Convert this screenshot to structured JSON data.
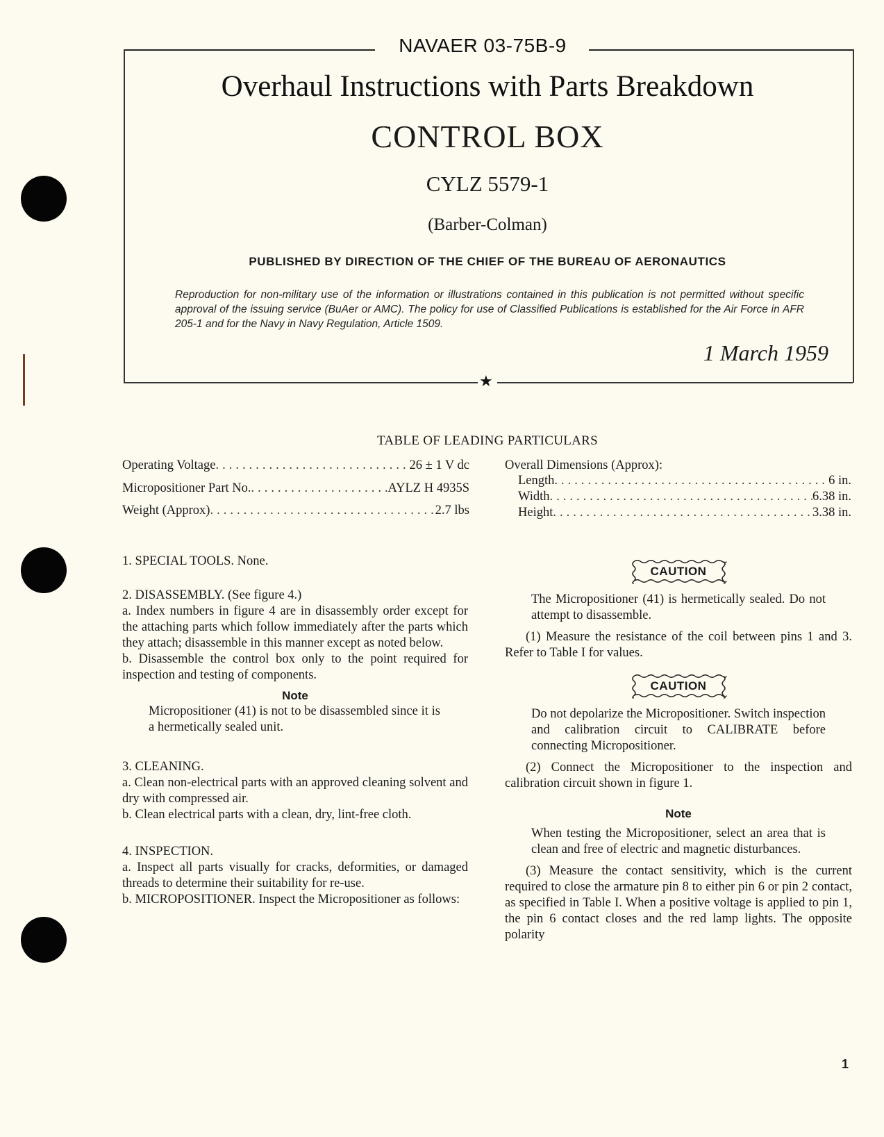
{
  "header": {
    "doc_number": "NAVAER 03-75B-9",
    "title": "Overhaul Instructions with Parts Breakdown",
    "subtitle": "CONTROL BOX",
    "model": "CYLZ 5579-1",
    "manufacturer": "(Barber-Colman)",
    "publisher": "PUBLISHED BY DIRECTION OF THE CHIEF OF THE BUREAU OF AERONAUTICS",
    "notice": "Reproduction for non-military use of the information or illustrations contained in this publication is not permitted without specific approval of the issuing service (BuAer or AMC). The policy for use of Classified Publications is established for the Air Force in AFR 205-1 and for the Navy in Navy Regulation, Article 1509.",
    "date": "1 March 1959",
    "divider_icon": "star-icon"
  },
  "particulars": {
    "title": "TABLE OF LEADING PARTICULARS",
    "left": [
      {
        "label": "Operating Voltage",
        "value": "26 ± 1 V dc"
      },
      {
        "label": "Micropositioner Part No.",
        "value": "AYLZ H 4935S"
      },
      {
        "label": "Weight (Approx)",
        "value": "2.7 lbs"
      }
    ],
    "right_heading": "Overall Dimensions (Approx):",
    "right": [
      {
        "label": "Length",
        "value": "6 in."
      },
      {
        "label": "Width",
        "value": "6.38 in."
      },
      {
        "label": "Height",
        "value": "3.38 in."
      }
    ]
  },
  "left_column": {
    "s1": "1. SPECIAL TOOLS. None.",
    "s2_heading": "2. DISASSEMBLY. (See figure 4.)",
    "s2a": "a. Index numbers in figure 4 are in disassembly order except for the attaching parts which follow immediately after the parts which they attach; disassemble in this manner except as noted below.",
    "s2b": "b. Disassemble the control box only to the point required for inspection and testing of components.",
    "note_title": "Note",
    "note_text": "Micropositioner (41) is not to be disassembled since it is a hermetically sealed unit.",
    "s3_heading": "3. CLEANING.",
    "s3a": "a. Clean non-electrical parts with an approved cleaning solvent and dry with compressed air.",
    "s3b": "b. Clean electrical parts with a clean, dry, lint-free cloth.",
    "s4_heading": "4. INSPECTION.",
    "s4a": "a. Inspect all parts visually for cracks, deformities, or damaged threads to determine their suitability for re-use.",
    "s4b": "b. MICROPOSITIONER. Inspect the Micropositioner as follows:"
  },
  "right_column": {
    "caution_label": "CAUTION",
    "caution1": "The Micropositioner (41) is hermetically sealed. Do not attempt to disassemble.",
    "step1": "(1) Measure the resistance of the coil between pins 1 and 3. Refer to Table I for values.",
    "caution2": "Do not depolarize the Micropositioner. Switch inspection and calibration circuit to CALIBRATE before connecting Micropositioner.",
    "step2": "(2) Connect the Micropositioner to the inspection and calibration circuit shown in figure 1.",
    "note_title": "Note",
    "note_text": "When testing the Micropositioner, select an area that is clean and free of electric and magnetic disturbances.",
    "step3": "(3) Measure the contact sensitivity, which is the current required to close the armature pin 8 to either pin 6 or pin 2 contact, as specified in Table I. When a positive voltage is applied to pin 1, the pin 6 contact closes and the red lamp lights. The opposite polarity"
  },
  "page_number": "1"
}
